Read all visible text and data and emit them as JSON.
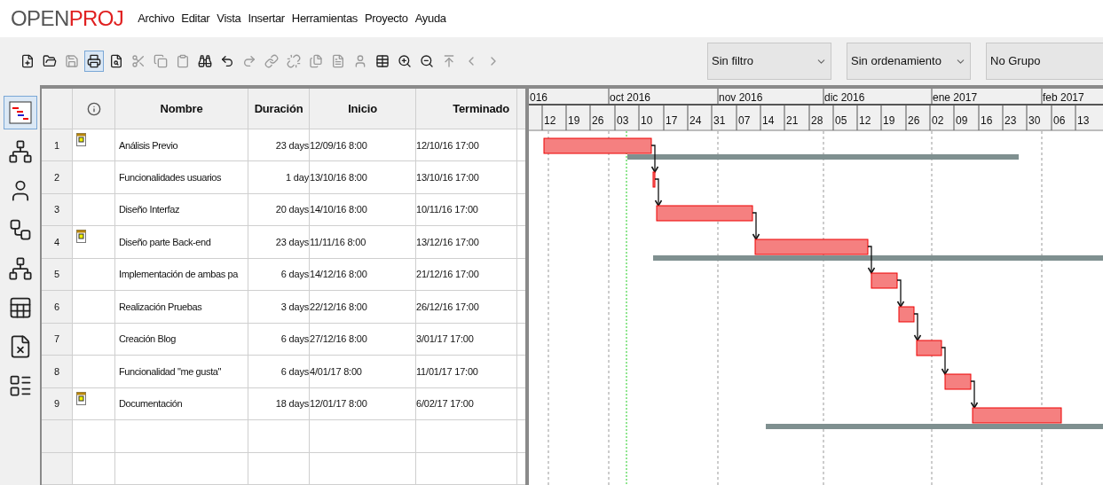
{
  "logo": {
    "part_1": "OPEN",
    "part_2": "PROJ"
  },
  "menu": [
    "Archivo",
    "Editar",
    "Vista",
    "Insertar",
    "Herramientas",
    "Proyecto",
    "Ayuda"
  ],
  "toolbar": [
    {
      "kind": "new",
      "disabled": false,
      "selected": false
    },
    {
      "kind": "open",
      "disabled": false,
      "selected": false
    },
    {
      "kind": "save",
      "disabled": true,
      "selected": false
    },
    {
      "kind": "print",
      "disabled": false,
      "selected": true
    },
    {
      "kind": "preview",
      "disabled": false,
      "selected": false
    },
    {
      "kind": "cut",
      "disabled": true,
      "selected": false
    },
    {
      "kind": "copy",
      "disabled": true,
      "selected": false
    },
    {
      "kind": "paste",
      "disabled": true,
      "selected": false
    },
    {
      "kind": "find",
      "disabled": false,
      "selected": false
    },
    {
      "kind": "undo",
      "disabled": false,
      "selected": false
    },
    {
      "kind": "redo",
      "disabled": true,
      "selected": false
    },
    {
      "kind": "link",
      "disabled": true,
      "selected": false
    },
    {
      "kind": "unlink",
      "disabled": true,
      "selected": false
    },
    {
      "kind": "notes",
      "disabled": true,
      "selected": false
    },
    {
      "kind": "document",
      "disabled": true,
      "selected": false
    },
    {
      "kind": "assign",
      "disabled": true,
      "selected": false
    },
    {
      "kind": "calendar",
      "disabled": false,
      "selected": false
    },
    {
      "kind": "zoom-in",
      "disabled": false,
      "selected": false
    },
    {
      "kind": "zoom-out",
      "disabled": false,
      "selected": false
    },
    {
      "kind": "scroll-to",
      "disabled": true,
      "selected": false
    },
    {
      "kind": "back",
      "disabled": true,
      "selected": false
    },
    {
      "kind": "forward",
      "disabled": true,
      "selected": false
    }
  ],
  "filters": [
    {
      "value": "Sin filtro"
    },
    {
      "value": "Sin ordenamiento"
    },
    {
      "value": "No Grupo"
    }
  ],
  "views": [
    {
      "kind": "gantt",
      "selected": true
    },
    {
      "kind": "network",
      "selected": false
    },
    {
      "kind": "resources",
      "selected": false
    },
    {
      "kind": "wbs",
      "selected": false
    },
    {
      "kind": "rbs",
      "selected": false
    },
    {
      "kind": "sheet",
      "selected": false
    },
    {
      "kind": "report",
      "selected": false
    },
    {
      "kind": "usage",
      "selected": false
    }
  ],
  "table": {
    "columns": [
      "Nombre",
      "Duración",
      "Inicio",
      "Terminado"
    ],
    "rows": [
      {
        "id": "1",
        "indicator": true,
        "name": "Análisis Previo",
        "duration": "23 days",
        "start": "12/09/16 8:00",
        "finish": "12/10/16 17:00"
      },
      {
        "id": "2",
        "indicator": false,
        "name": "Funcionalidades usuarios",
        "duration": "1 day",
        "start": "13/10/16 8:00",
        "finish": "13/10/16 17:00"
      },
      {
        "id": "3",
        "indicator": false,
        "name": "Diseño Interfaz",
        "duration": "20 days",
        "start": "14/10/16 8:00",
        "finish": "10/11/16 17:00"
      },
      {
        "id": "4",
        "indicator": true,
        "name": "Diseño parte Back-end",
        "duration": "23 days",
        "start": "11/11/16 8:00",
        "finish": "13/12/16 17:00"
      },
      {
        "id": "5",
        "indicator": false,
        "name": "Implementación de ambas pa",
        "duration": "6 days",
        "start": "14/12/16 8:00",
        "finish": "21/12/16 17:00"
      },
      {
        "id": "6",
        "indicator": false,
        "name": "Realización Pruebas",
        "duration": "3 days",
        "start": "22/12/16 8:00",
        "finish": "26/12/16 17:00"
      },
      {
        "id": "7",
        "indicator": false,
        "name": "Creación Blog",
        "duration": "6 days",
        "start": "27/12/16 8:00",
        "finish": "3/01/17 17:00"
      },
      {
        "id": "8",
        "indicator": false,
        "name": "Funcionalidad \"me gusta\"",
        "duration": "6 days",
        "start": "4/01/17 8:00",
        "finish": "11/01/17 17:00"
      },
      {
        "id": "9",
        "indicator": true,
        "name": "Documentación",
        "duration": "18 days",
        "start": "12/01/17 8:00",
        "finish": "6/02/17 17:00"
      }
    ]
  },
  "timeline": {
    "months": [
      "016",
      "oct 2016",
      "nov 2016",
      "dic 2016",
      "ene 2017",
      "feb 2017"
    ],
    "weeks": [
      "12",
      "19",
      "26",
      "03",
      "10",
      "17",
      "24",
      "31",
      "07",
      "14",
      "21",
      "28",
      "05",
      "12",
      "19",
      "26",
      "02",
      "09",
      "16",
      "23",
      "30",
      "06",
      "13"
    ]
  }
}
